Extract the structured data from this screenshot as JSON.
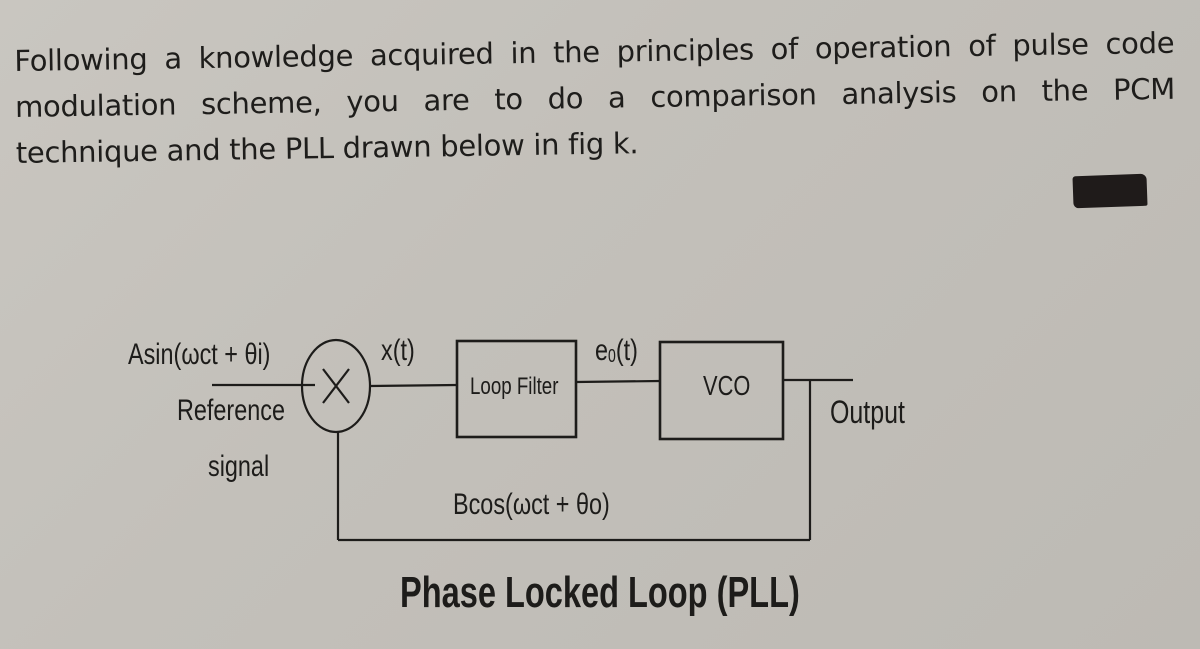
{
  "question": {
    "lines": [
      "Following a knowledge acquired in the principles of operation of pulse code",
      "modulation scheme, you are to do a comparison analysis on the PCM",
      "technique and the PLL drawn below in fig k."
    ]
  },
  "redaction": {
    "icon": "redacted-marker-block"
  },
  "diagram": {
    "title": "Phase Locked Loop (PLL)",
    "input_signal": "Asin(ωct + θi)",
    "input_label_line1": "Reference",
    "input_label_line2": "signal",
    "multiplier_symbol": "X",
    "mixer_output": "x(t)",
    "loop_filter_label": "Loop Filter",
    "filter_output": "e",
    "filter_output_sub": "0",
    "filter_output_suffix": "(t)",
    "vco_label": "VCO",
    "output_label": "Output",
    "feedback_signal": "Bcos(ωct + θo)"
  },
  "colors": {
    "paper": "#c6c3bd",
    "ink": "#1d1c1a"
  }
}
